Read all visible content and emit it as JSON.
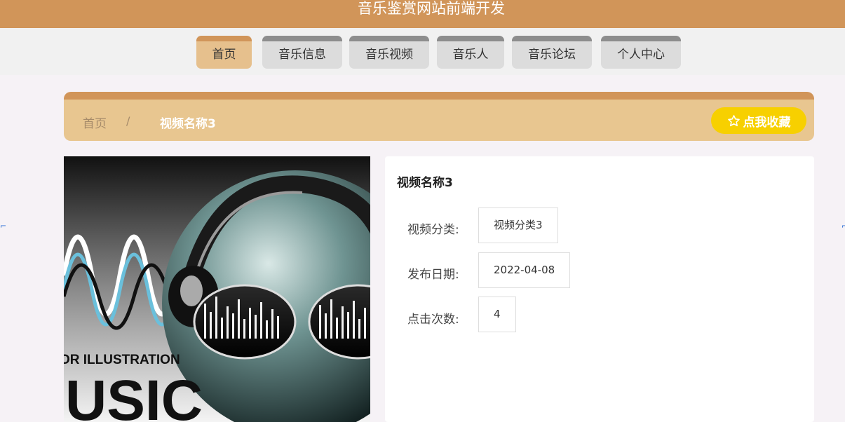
{
  "header": {
    "site_title": "音乐鉴赏网站前端开发"
  },
  "nav": {
    "tabs": [
      {
        "label": "首页",
        "active": true
      },
      {
        "label": "音乐信息"
      },
      {
        "label": "音乐视频"
      },
      {
        "label": "音乐人"
      },
      {
        "label": "音乐论坛"
      },
      {
        "label": "个人中心"
      }
    ]
  },
  "breadcrumb": {
    "home": "首页",
    "separator": "/",
    "current": "视频名称3"
  },
  "favorite": {
    "icon": "star-outline-icon",
    "label": "点我收藏"
  },
  "cover": {
    "text_line1": "OR ILLUSTRATION",
    "text_line2": "USIC"
  },
  "detail": {
    "title": "视频名称3",
    "fields": [
      {
        "label": "视频分类:",
        "value": "视频分类3"
      },
      {
        "label": "发布日期:",
        "value": "2022-04-08"
      },
      {
        "label": "点击次数:",
        "value": "4"
      }
    ]
  },
  "colors": {
    "brand": "#d19559",
    "breadcrumb_bg": "#e8c690",
    "active_tab": "#e6c08d",
    "favorite_button": "#f7d000"
  }
}
